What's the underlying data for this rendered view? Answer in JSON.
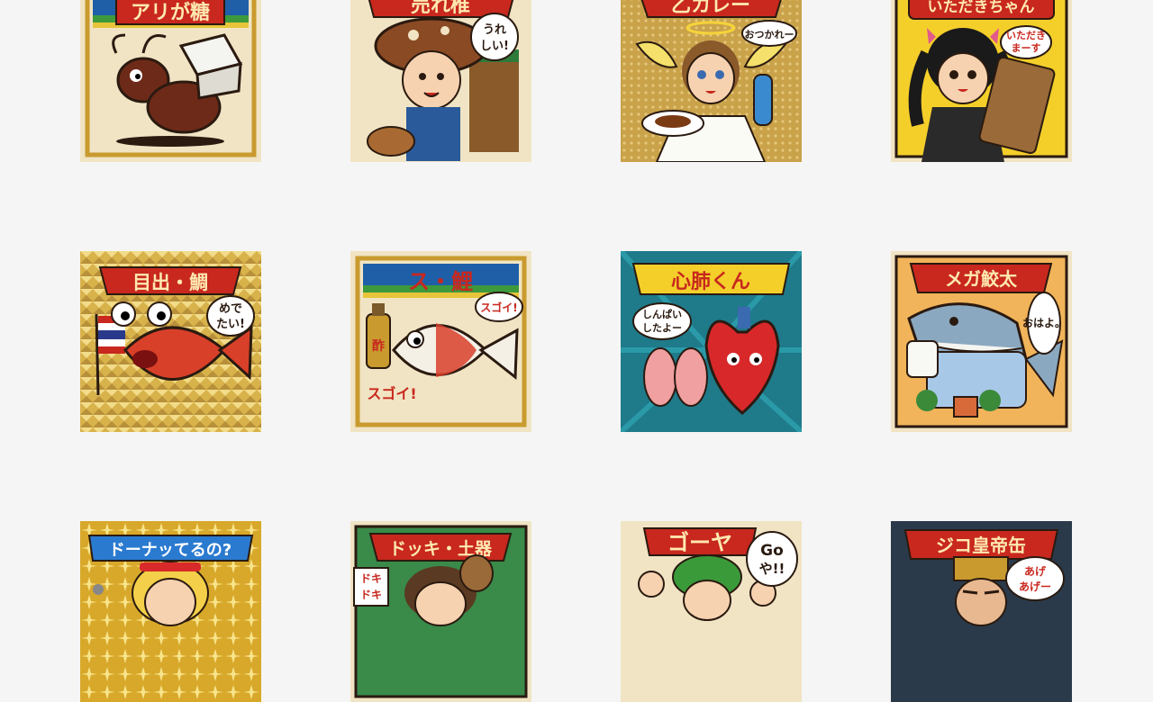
{
  "stickers": [
    {
      "title": "アリが糖",
      "bubble": []
    },
    {
      "title": "売れ椎",
      "bubble": [
        "うれ",
        "しい!"
      ]
    },
    {
      "title": "乙カレー",
      "bubble": [
        "おつかれー"
      ]
    },
    {
      "title": "いただきちゃん",
      "bubble": [
        "いただき",
        "まーす"
      ]
    },
    {
      "title": "目出・鯛",
      "bubble": [
        "めで",
        "たい!"
      ]
    },
    {
      "title": "ス・鯉",
      "bubble": [
        "スゴイ!"
      ],
      "extra": "スゴイ!",
      "bottle": "酢"
    },
    {
      "title": "心肺くん",
      "bubble": [
        "しんぱい",
        "したよー"
      ]
    },
    {
      "title": "メガ鮫太",
      "bubble": [
        "おはよ。"
      ]
    },
    {
      "title": "ドーナッてるの?",
      "bubble": []
    },
    {
      "title": "ドッキ・土器",
      "bubble": [
        "ドキ",
        "ドキ"
      ]
    },
    {
      "title": "ゴーヤ",
      "bubble": [
        "Go",
        "や!!"
      ]
    },
    {
      "title": "ジコ皇帝缶",
      "bubble": [
        "あげ",
        "あげー"
      ]
    }
  ],
  "colors": {
    "page_bg": "#f5f5f5",
    "banner_red": "#c8281e",
    "frame_gold": "#c99a2e",
    "card_cream": "#f1e4c4"
  }
}
